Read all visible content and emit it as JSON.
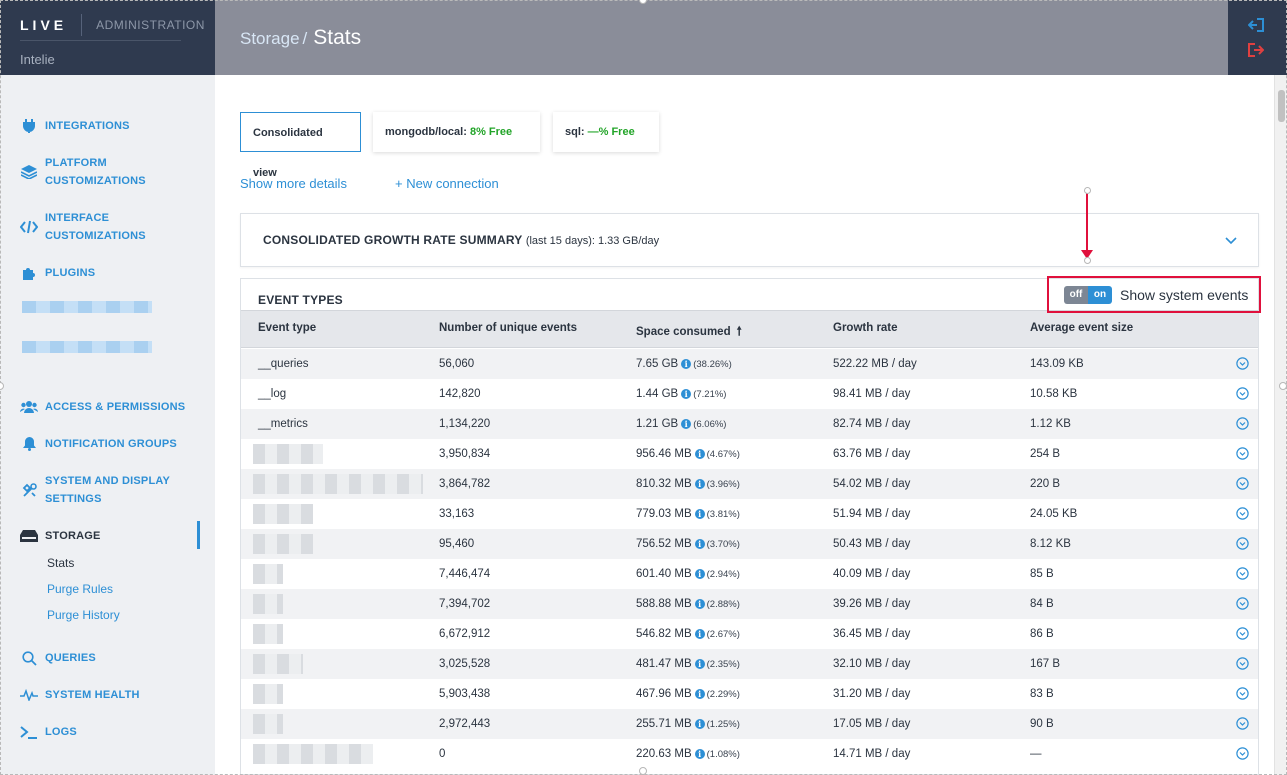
{
  "app": {
    "logo": "LIVE",
    "section": "ADMINISTRATION",
    "company": "Intelie"
  },
  "header": {
    "breadcrumb_parent": "Storage",
    "separator": "/",
    "breadcrumb_current": "Stats"
  },
  "sidebar": {
    "items": [
      {
        "label": "INTEGRATIONS",
        "icon": "plug-icon"
      },
      {
        "label": "PLATFORM",
        "label2": "CUSTOMIZATIONS",
        "icon": "layers-icon"
      },
      {
        "label": "INTERFACE",
        "label2": "CUSTOMIZATIONS",
        "icon": "code-icon"
      },
      {
        "label": "PLUGINS",
        "icon": "puzzle-icon"
      },
      {
        "label": "ACCESS & PERMISSIONS",
        "icon": "users-icon"
      },
      {
        "label": "NOTIFICATION GROUPS",
        "icon": "bell-icon"
      },
      {
        "label": "SYSTEM AND DISPLAY",
        "label2": "SETTINGS",
        "icon": "tools-icon"
      },
      {
        "label": "STORAGE",
        "icon": "drive-icon"
      },
      {
        "label": "QUERIES",
        "icon": "search-icon"
      },
      {
        "label": "SYSTEM HEALTH",
        "icon": "pulse-icon"
      },
      {
        "label": "LOGS",
        "icon": "terminal-icon"
      }
    ],
    "storage_sub": [
      "Stats",
      "Purge Rules",
      "Purge History"
    ]
  },
  "tabs": {
    "consolidated": "Consolidated view",
    "mongo_label": "mongodb/local:",
    "mongo_free": "8% Free",
    "sql_label": "sql:",
    "sql_free": "—% Free"
  },
  "links": {
    "more_details": "Show more details",
    "new_connection": "+ New connection"
  },
  "summary": {
    "title": "CONSOLIDATED GROWTH RATE SUMMARY",
    "subtitle": "(last 15 days): 1.33 GB/day"
  },
  "events": {
    "title": "EVENT TYPES",
    "toggle_off": "off",
    "toggle_on": "on",
    "toggle_label": "Show system events",
    "columns": [
      "Event type",
      "Number of unique events",
      "Space consumed",
      "Growth rate",
      "Average event size"
    ],
    "sort_indicator": "🠕",
    "rows": [
      {
        "name": "__queries",
        "count": "56,060",
        "space": "7.65 GB",
        "pct": "(38.26%)",
        "growth": "522.22 MB / day",
        "avg": "143.09 KB"
      },
      {
        "name": "__log",
        "count": "142,820",
        "space": "1.44 GB",
        "pct": "(7.21%)",
        "growth": "98.41 MB / day",
        "avg": "10.58 KB"
      },
      {
        "name": "__metrics",
        "count": "1,134,220",
        "space": "1.21 GB",
        "pct": "(6.06%)",
        "growth": "82.74 MB / day",
        "avg": "1.12 KB"
      },
      {
        "name": "",
        "count": "3,950,834",
        "space": "956.46 MB",
        "pct": "(4.67%)",
        "growth": "63.76 MB / day",
        "avg": "254 B"
      },
      {
        "name": "",
        "count": "3,864,782",
        "space": "810.32 MB",
        "pct": "(3.96%)",
        "growth": "54.02 MB / day",
        "avg": "220 B"
      },
      {
        "name": "",
        "count": "33,163",
        "space": "779.03 MB",
        "pct": "(3.81%)",
        "growth": "51.94 MB / day",
        "avg": "24.05 KB"
      },
      {
        "name": "",
        "count": "95,460",
        "space": "756.52 MB",
        "pct": "(3.70%)",
        "growth": "50.43 MB / day",
        "avg": "8.12 KB"
      },
      {
        "name": "",
        "count": "7,446,474",
        "space": "601.40 MB",
        "pct": "(2.94%)",
        "growth": "40.09 MB / day",
        "avg": "85 B"
      },
      {
        "name": "",
        "count": "7,394,702",
        "space": "588.88 MB",
        "pct": "(2.88%)",
        "growth": "39.26 MB / day",
        "avg": "84 B"
      },
      {
        "name": "",
        "count": "6,672,912",
        "space": "546.82 MB",
        "pct": "(2.67%)",
        "growth": "36.45 MB / day",
        "avg": "86 B"
      },
      {
        "name": "",
        "count": "3,025,528",
        "space": "481.47 MB",
        "pct": "(2.35%)",
        "growth": "32.10 MB / day",
        "avg": "167 B"
      },
      {
        "name": "",
        "count": "5,903,438",
        "space": "467.96 MB",
        "pct": "(2.29%)",
        "growth": "31.20 MB / day",
        "avg": "83 B"
      },
      {
        "name": "",
        "count": "2,972,443",
        "space": "255.71 MB",
        "pct": "(1.25%)",
        "growth": "17.05 MB / day",
        "avg": "90 B"
      },
      {
        "name": "",
        "count": "0",
        "space": "220.63 MB",
        "pct": "(1.08%)",
        "growth": "14.71 MB / day",
        "avg": "—"
      }
    ]
  },
  "colors": {
    "accent": "#2d8fd5",
    "sidebar_dark": "#2f3a4f",
    "free_green": "#22a428",
    "highlight_red": "#e0103c"
  }
}
